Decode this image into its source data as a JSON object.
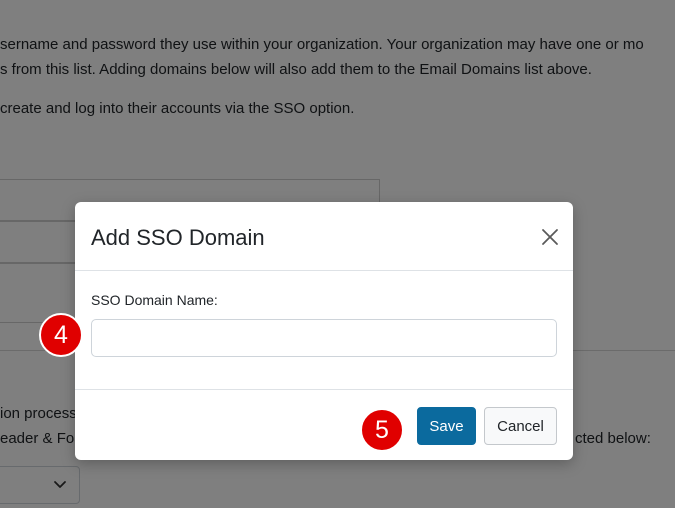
{
  "background": {
    "lines": [
      "sername and password they use within your organization. Your organization may have one or mo",
      "s from this list. Adding domains below will also add them to the Email Domains list above.",
      "create and log into their accounts via the SSO option.",
      "ion process",
      "eader & Fo",
      "cted below:"
    ]
  },
  "modal": {
    "title": "Add SSO Domain",
    "field_label": "SSO Domain Name:",
    "field_value": "",
    "field_placeholder": "",
    "save_label": "Save",
    "cancel_label": "Cancel"
  },
  "markers": {
    "step_4": "4",
    "step_5": "5"
  },
  "colors": {
    "primary_button": "#0b6a9e",
    "step_marker": "#e00000"
  },
  "icons": {
    "close": "close-icon",
    "select_chevron": "chevron-down-icon"
  }
}
